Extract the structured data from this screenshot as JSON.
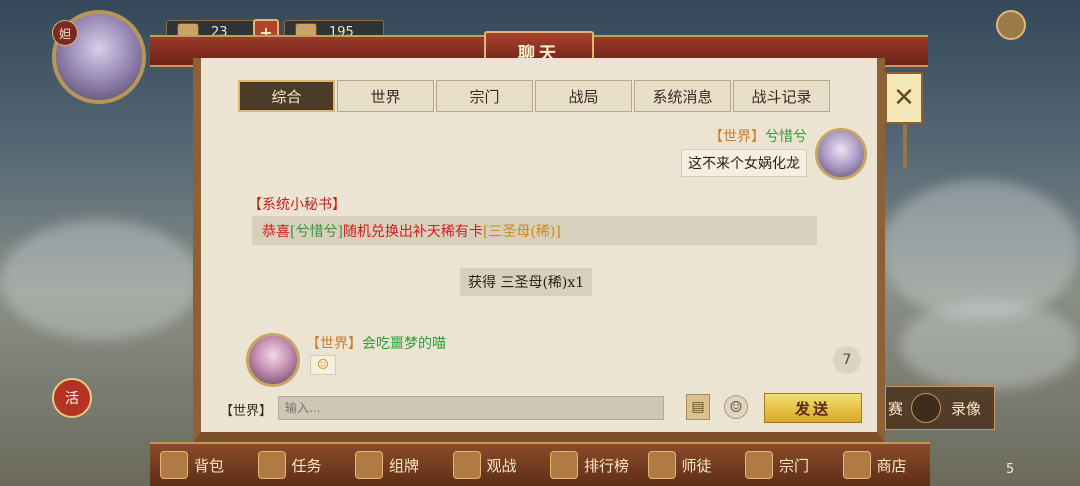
{
  "hud": {
    "avatar_tag": "妲",
    "resource1": "23",
    "resource2": "195",
    "plus": "+"
  },
  "dialog": {
    "title": "聊天",
    "tabs": [
      "综合",
      "世界",
      "宗门",
      "战局",
      "系统消息",
      "战斗记录"
    ],
    "active_tab": "综合",
    "close_symbol": "✕"
  },
  "messages": {
    "m1": {
      "channel": "【世界】",
      "name": "兮惜兮",
      "text": "这不来个女娲化龙"
    },
    "system": {
      "title": "【系统小秘书】",
      "p1": "恭喜",
      "p2": "[兮惜兮]",
      "p3": "随机兑换出补天稀有卡",
      "p4": "[三圣母(稀)]"
    },
    "obtain": "获得 三圣母(稀)x1",
    "m2": {
      "channel": "【世界】",
      "name": "会吃噩梦的喵",
      "emoji": "☺"
    }
  },
  "unread_count": "7",
  "input": {
    "channel": "【世界】",
    "placeholder": "输入...",
    "book_icon": "▤",
    "emoji_icon": "☺",
    "send": "发送"
  },
  "bottom_nav": [
    "背包",
    "任务",
    "组牌",
    "观战",
    "排行榜",
    "师徒",
    "宗门",
    "商店"
  ],
  "right_panel": {
    "left_label": "赛",
    "label": "录像"
  },
  "seal": "活",
  "bag_count": "5"
}
